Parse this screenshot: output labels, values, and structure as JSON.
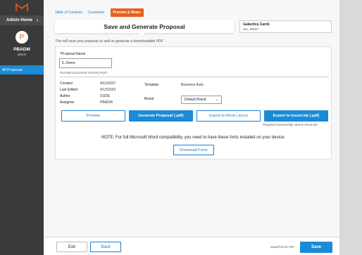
{
  "sidebar": {
    "admin_home": "Admin Home",
    "user_initial": "P",
    "user_name": "PBADM",
    "user_role": "admin",
    "nav_item": "All Proposals"
  },
  "tabs": {
    "table_of_contents": "Table of Contents",
    "customize": "Customize",
    "preview_share": "Preview & Share"
  },
  "header": {
    "title": "Save and Generate Proposal",
    "client_name": "Galactica Cards",
    "client_address": "WA, 98007"
  },
  "subtitle": "This will save your proposal as well as generate a downloadable PDF",
  "form": {
    "proposal_name_label": "*Proposal Name",
    "proposal_name_value": "IL Demo",
    "format_hint": "Portable Document Format (PDF)",
    "created_label": "Created",
    "created_value": "4/11/2022",
    "edited_label": "Last Edited",
    "edited_value": "4/12/2022",
    "author_label": "Author",
    "author_value": "DUDE",
    "assignee_label": "Assignee",
    "assignee_value": "PBADM",
    "template_label": "Template",
    "template_value": "Business Auto",
    "brand_label": "Brand",
    "brand_value": "Default Brand"
  },
  "actions": {
    "preview": "Preview",
    "generate_pdf": "Generate Proposal (.pdf)",
    "export_word": "Export to Word (.docx)",
    "export_insurlink": "Export to InsurLink (.pdf)",
    "insurlink_status": "Proposal successfully sent to InsurLink."
  },
  "note": "NOTE: For full Microsoft Word compatibility, you need to have these fonts installed on your device:",
  "download_fonts": "Download Fonts",
  "footer": {
    "exit": "Exit",
    "back": "Back",
    "saved": "Saved 03:11 PM",
    "save": "Save"
  },
  "colors": {
    "accent": "#1a8bd6",
    "brand_orange": "#e8601c",
    "sidebar_bg": "#3a3a3a"
  }
}
